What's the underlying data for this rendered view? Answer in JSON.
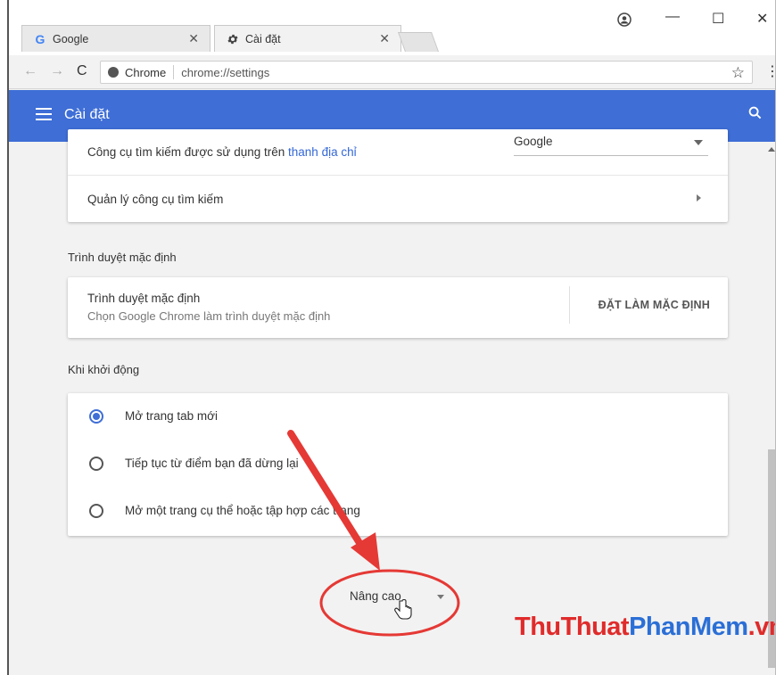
{
  "tabs": [
    {
      "label": "Google",
      "icon": "google-logo-icon"
    },
    {
      "label": "Cài đặt",
      "icon": "gear-icon"
    }
  ],
  "omnibox": {
    "site": "Chrome",
    "url": "chrome://settings"
  },
  "header": {
    "title": "Cài đặt"
  },
  "search_engine": {
    "label_prefix": "Công cụ tìm kiếm được sử dụng trên ",
    "label_link": "thanh địa chỉ",
    "selected": "Google",
    "manage_label": "Quản lý công cụ tìm kiếm"
  },
  "default_browser": {
    "section_title": "Trình duyệt mặc định",
    "row_title": "Trình duyệt mặc định",
    "row_subtitle": "Chọn Google Chrome làm trình duyệt mặc định",
    "button": "ĐẶT LÀM MẶC ĐỊNH"
  },
  "on_startup": {
    "section_title": "Khi khởi động",
    "options": [
      {
        "label": "Mở trang tab mới",
        "selected": true
      },
      {
        "label": "Tiếp tục từ điểm bạn đã dừng lại",
        "selected": false
      },
      {
        "label": "Mở một trang cụ thể hoặc tập hợp các trang",
        "selected": false
      }
    ]
  },
  "advanced": {
    "label": "Nâng cao"
  },
  "watermark": {
    "part1": "ThuThuat",
    "part2": "PhanMem",
    "part3": ".vn"
  },
  "colors": {
    "header": "#3e6ed6",
    "link": "#3367d6",
    "annotation": "#e53935"
  }
}
